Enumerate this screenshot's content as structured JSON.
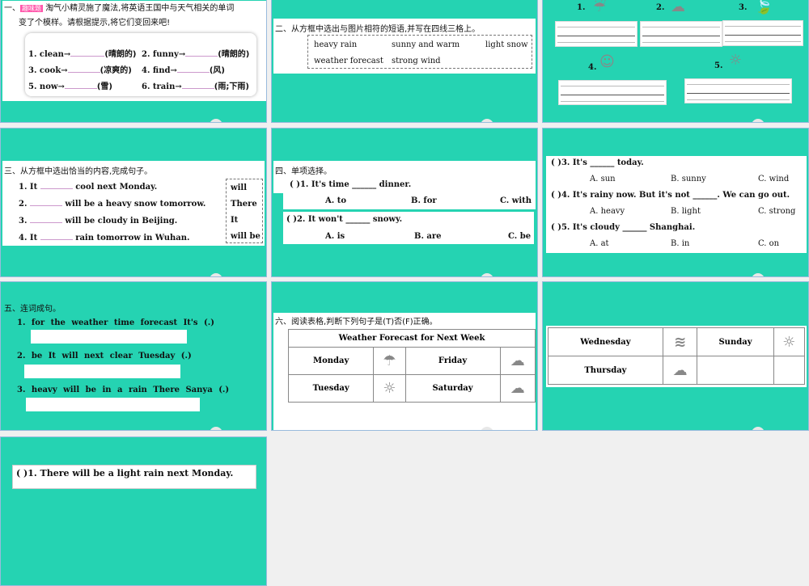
{
  "slide1": {
    "num": "一、",
    "badge": "趣味题",
    "intro1": "淘气小精灵施了魔法,将英语王国中与天气相关的单词",
    "intro2": "变了个模样。请根据提示,将它们变回来吧!",
    "items": [
      {
        "w": "1. clean→",
        "h": "(晴朗的)"
      },
      {
        "w": "2. funny→",
        "h": "(晴朗的)"
      },
      {
        "w": "3. cook→",
        "h": "(凉爽的)"
      },
      {
        "w": "4. find→",
        "h": "(风)"
      },
      {
        "w": "5. now→",
        "h": "(雪)"
      },
      {
        "w": "6. train→",
        "h": "(雨;下雨)"
      }
    ]
  },
  "slide2": {
    "title": "二、从方框中选出与图片相符的短语,并写在四线三格上。",
    "phrases": [
      "heavy rain",
      "sunny and warm",
      "light snow",
      "weather forecast",
      "strong wind"
    ]
  },
  "slide3": {
    "nums": [
      "1.",
      "2.",
      "3.",
      "4.",
      "5."
    ]
  },
  "slide4": {
    "title": "三、从方框中选出恰当的内容,完成句子。",
    "sentences": [
      {
        "a": "1. It",
        "b": "cool next Monday."
      },
      {
        "a": "2.",
        "b": "will be a heavy snow tomorrow."
      },
      {
        "a": "3.",
        "b": "will be cloudy in Beijing."
      },
      {
        "a": "4. It",
        "b": "rain tomorrow in Wuhan."
      }
    ],
    "options": [
      "will",
      "There",
      "It",
      "will be"
    ]
  },
  "slide5": {
    "title": "四、单项选择。",
    "q1": "( )1. It's time ______ dinner.",
    "q1opts": [
      "A. to",
      "B. for",
      "C. with"
    ],
    "q2": "( )2. It won't ______ snowy.",
    "q2opts": [
      "A. is",
      "B. are",
      "C. be"
    ]
  },
  "slide6": {
    "q3": "( )3. It's ______ today.",
    "q3opts": [
      "A. sun",
      "B. sunny",
      "C. wind"
    ],
    "q4": "( )4. It's rainy now. But it's not ______. We can go out.",
    "q4opts": [
      "A. heavy",
      "B. light",
      "C. strong"
    ],
    "q5": "( )5. It's cloudy ______ Shanghai.",
    "q5opts": [
      "A. at",
      "B. in",
      "C. on"
    ]
  },
  "slide7": {
    "title": "五、连词成句。",
    "items": [
      "1. for  the  weather  time  forecast  It's  (.)",
      "2. be  It  will  next  clear  Tuesday  (.)",
      "3. heavy  will  be  in  a  rain  There  Sanya  (.)"
    ]
  },
  "slide8": {
    "title": "六、阅读表格,判断下列句子是(T)否(F)正确。",
    "table_title": "Weather Forecast for Next Week",
    "days": [
      "Monday",
      "Friday",
      "Tuesday",
      "Saturday"
    ]
  },
  "slide9": {
    "days": [
      "Wednesday",
      "Sunday",
      "Thursday"
    ]
  },
  "slide10": {
    "q1": "(    )1. There will be a light rain next Monday."
  }
}
